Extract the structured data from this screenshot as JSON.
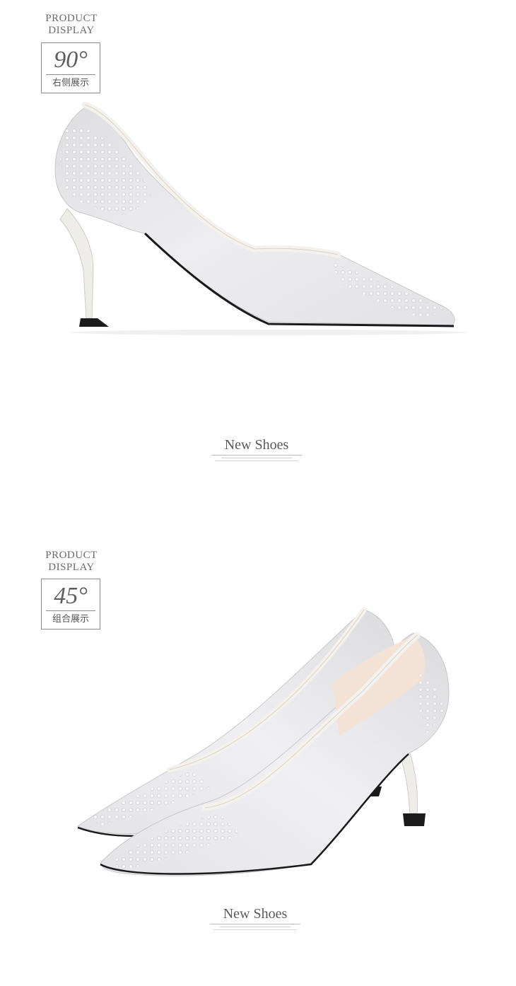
{
  "sections": [
    {
      "product_label": "PRODUCT",
      "display_label": "DISPLAY",
      "angle": "90°",
      "view_name": "右侧展示",
      "brand": "New Shoes"
    },
    {
      "product_label": "PRODUCT",
      "display_label": "DISPLAY",
      "angle": "45°",
      "view_name": "组合展示",
      "brand": "New Shoes"
    }
  ],
  "colors": {
    "shoe_body": "#e9e9eb",
    "shoe_trim": "#f3f0eb",
    "sole": "#1a1a1a",
    "label_border": "#8d8d8d"
  }
}
